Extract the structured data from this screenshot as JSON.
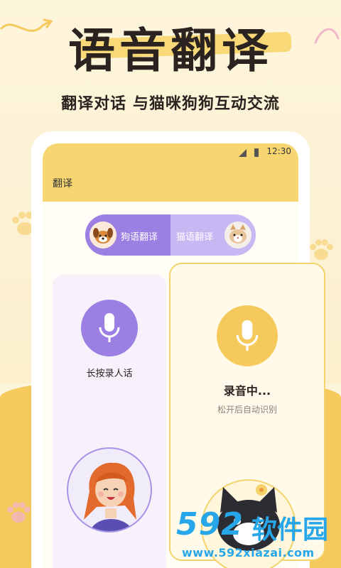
{
  "headline": "语音翻译",
  "subtitle": "翻译对话 与猫咪狗狗互动交流",
  "status_bar": {
    "time": "12:30"
  },
  "app": {
    "title": "翻译"
  },
  "toggle": {
    "dog_label": "狗语翻译",
    "cat_label": "猫语翻译",
    "selected": "dog"
  },
  "left_card": {
    "label": "长按录人话"
  },
  "right_card": {
    "status": "录音中...",
    "hint": "松开后自动识别"
  },
  "watermark": {
    "number": "592",
    "brand": "软件园",
    "url": "www.592xiazai.com"
  },
  "colors": {
    "accent_purple": "#9b7fe3",
    "accent_yellow": "#f5c95c",
    "appbar": "#f7d671",
    "watermark_blue": "#27a7ea"
  },
  "icons": [
    "microphone-icon",
    "dog-avatar",
    "cat-avatar",
    "girl-illustration",
    "cat-illustration",
    "paw-icon",
    "signal-icon",
    "battery-icon"
  ]
}
